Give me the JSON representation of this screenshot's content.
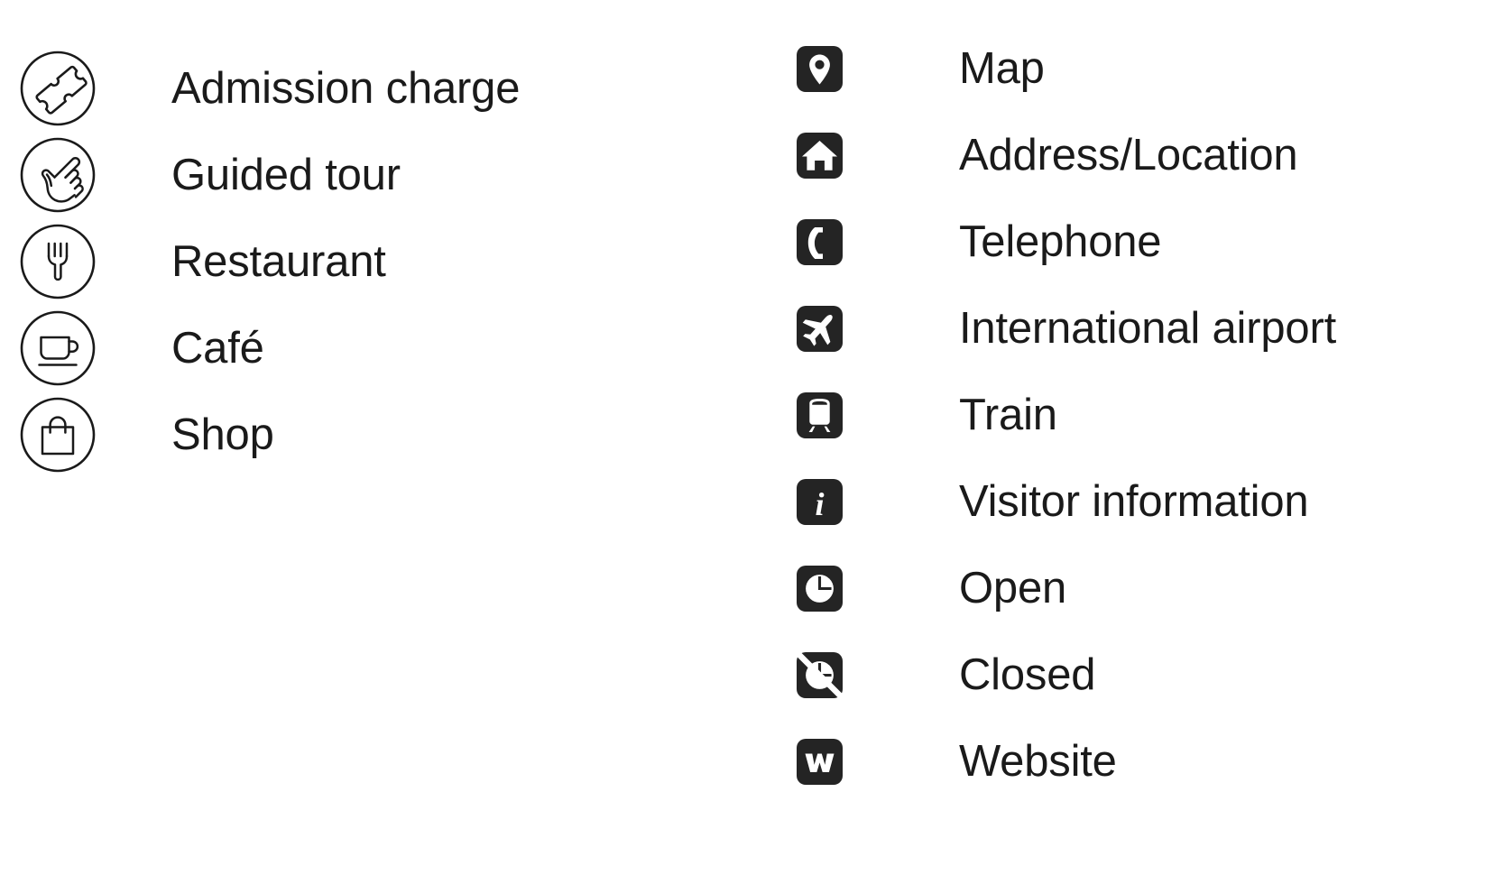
{
  "sheet": {
    "background_color": "#ffffff",
    "text_color": "#1a1a1a",
    "tile_color": "#242424",
    "glyph_color": "#ffffff"
  },
  "facilities_column": {
    "items": [
      {
        "label": "Admission charge",
        "icon": "ticket-icon",
        "style": "outline-circle"
      },
      {
        "label": "Guided tour",
        "icon": "pointing-hand-icon",
        "style": "outline-circle"
      },
      {
        "label": "Restaurant",
        "icon": "fork-icon",
        "style": "outline-circle"
      },
      {
        "label": "Café",
        "icon": "coffee-cup-icon",
        "style": "outline-circle"
      },
      {
        "label": "Shop",
        "icon": "shopping-bag-icon",
        "style": "outline-circle"
      }
    ]
  },
  "info_column": {
    "items": [
      {
        "label": "Map",
        "icon": "map-pin-icon",
        "style": "filled-tile"
      },
      {
        "label": "Address/Location",
        "icon": "house-icon",
        "style": "filled-tile"
      },
      {
        "label": "Telephone",
        "icon": "telephone-icon",
        "style": "filled-tile"
      },
      {
        "label": "International airport",
        "icon": "airplane-icon",
        "style": "filled-tile"
      },
      {
        "label": "Train",
        "icon": "train-icon",
        "style": "filled-tile"
      },
      {
        "label": "Visitor information",
        "icon": "information-i-icon",
        "style": "filled-tile"
      },
      {
        "label": "Open",
        "icon": "clock-icon",
        "style": "filled-tile"
      },
      {
        "label": "Closed",
        "icon": "clock-slashed-icon",
        "style": "filled-tile"
      },
      {
        "label": "Website",
        "icon": "website-w-icon",
        "style": "filled-tile"
      }
    ]
  }
}
